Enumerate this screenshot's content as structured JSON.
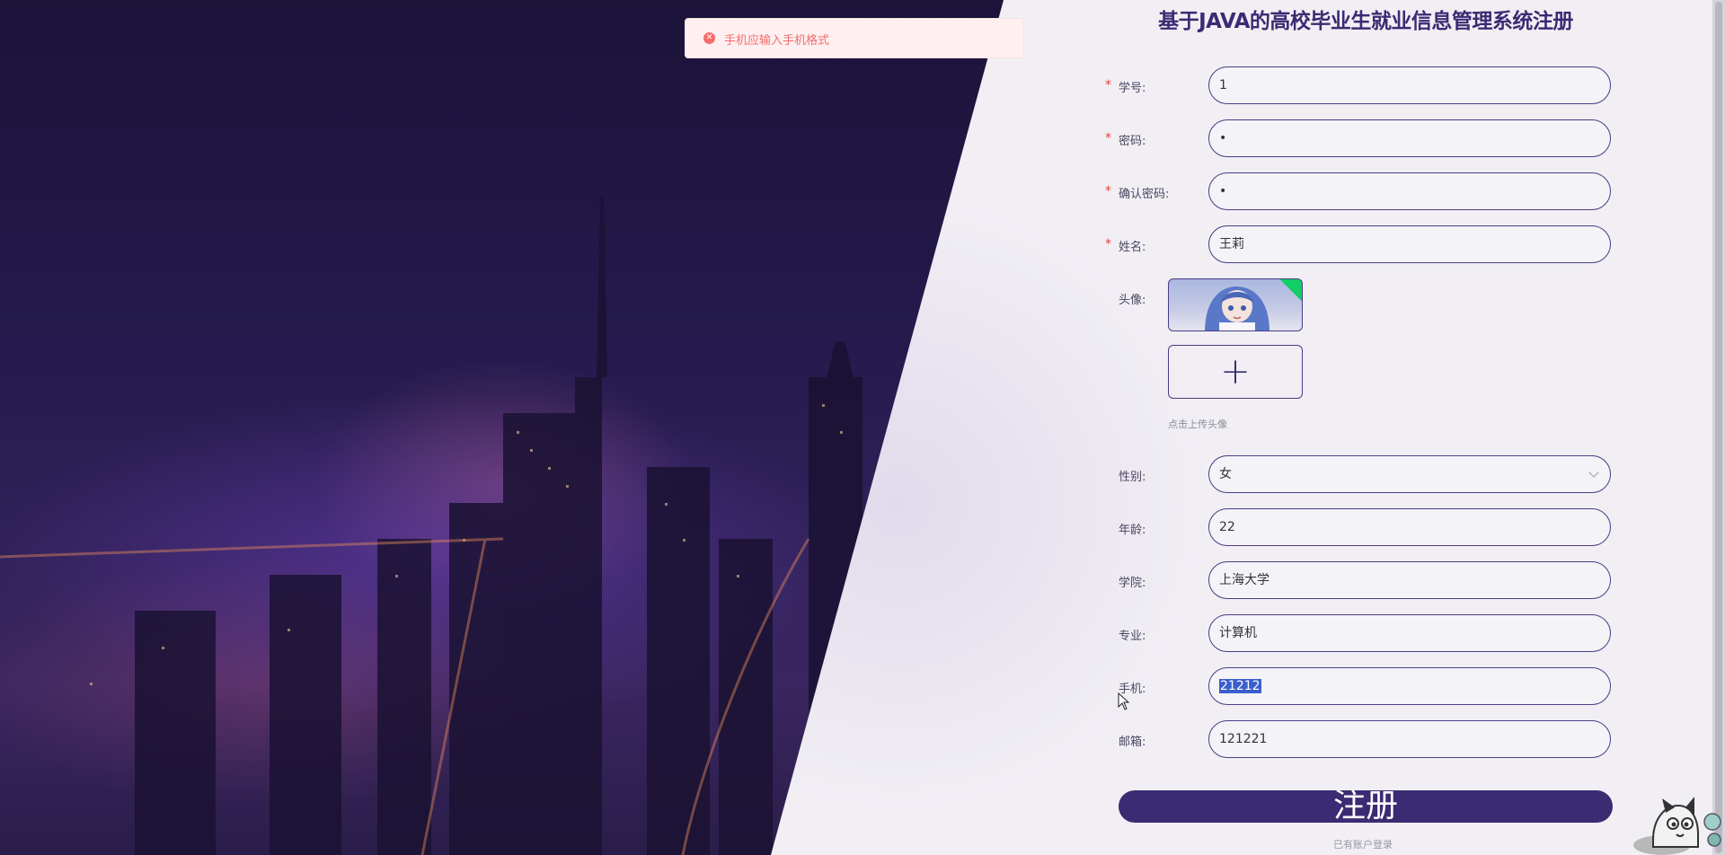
{
  "page": {
    "title": "基于JAVA的高校毕业生就业信息管理系统注册"
  },
  "toast": {
    "icon": "error-circle-icon",
    "message": "手机应输入手机格式",
    "color": "#f56c6c"
  },
  "form": {
    "student_id": {
      "label": "学号:",
      "value": "1",
      "required": true
    },
    "password": {
      "label": "密码:",
      "value": "•",
      "required": true
    },
    "confirm_password": {
      "label": "确认密码:",
      "value": "•",
      "required": true
    },
    "name": {
      "label": "姓名:",
      "value": "王莉",
      "required": true
    },
    "avatar": {
      "label": "头像:",
      "upload_icon": "plus-icon",
      "tip": "点击上传头像",
      "upload_status": "success"
    },
    "gender": {
      "label": "性别:",
      "value": "女"
    },
    "age": {
      "label": "年龄:",
      "value": "22"
    },
    "college": {
      "label": "学院:",
      "value": "上海大学"
    },
    "major": {
      "label": "专业:",
      "value": "计算机"
    },
    "phone": {
      "label": "手机:",
      "value": "21212"
    },
    "email": {
      "label": "邮箱:",
      "value": "121221"
    }
  },
  "actions": {
    "submit_label": "注册",
    "login_link": "已有账户登录"
  },
  "colors": {
    "primary": "#3a2b73",
    "required": "#e0413b",
    "success": "#13ce66"
  }
}
